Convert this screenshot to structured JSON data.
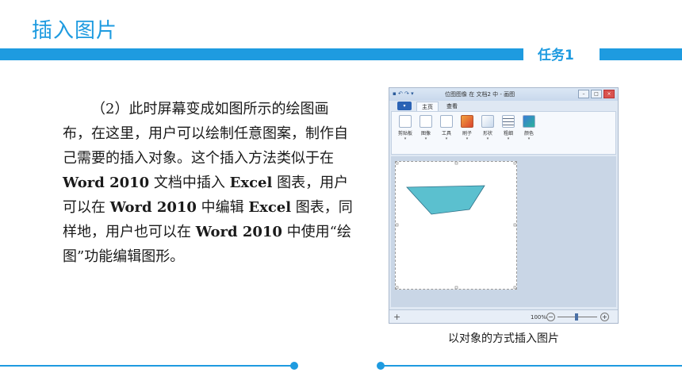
{
  "header": {
    "title": "插入图片",
    "task_label": "任务1"
  },
  "body": {
    "paragraph": [
      {
        "t": "（2）此时屏幕变成如图所示的绘图画布，在这里，用户可以绘制任意图案，制作自己需要的插入对象。这个插入方法类似于在 ",
        "b": false
      },
      {
        "t": "Word 2010",
        "b": true
      },
      {
        "t": " 文档中插入 ",
        "b": false
      },
      {
        "t": "Excel",
        "b": true
      },
      {
        "t": " 图表，用户可以在 ",
        "b": false
      },
      {
        "t": "Word 2010",
        "b": true
      },
      {
        "t": " 中编辑 ",
        "b": false
      },
      {
        "t": "Excel",
        "b": true
      },
      {
        "t": " 图表，同样地，用户也可以在 ",
        "b": false
      },
      {
        "t": "Word 2010",
        "b": true
      },
      {
        "t": " 中使用“绘图”功能编辑图形。",
        "b": false
      }
    ]
  },
  "screenshot": {
    "window_title": "位图图像 在 文档2 中 - 画图",
    "file_tab": "▾",
    "tabs": [
      "主页",
      "查看"
    ],
    "ribbon_groups": [
      {
        "label": "剪贴板",
        "icon": "clipboard-icon"
      },
      {
        "label": "图像",
        "icon": "image-icon"
      },
      {
        "label": "工具",
        "icon": "tools-icon"
      },
      {
        "label": "刷子",
        "icon": "brush-icon"
      },
      {
        "label": "形状",
        "icon": "shapes-icon"
      },
      {
        "label": "粗细",
        "icon": "line-width-icon"
      },
      {
        "label": "颜色",
        "icon": "color-icon"
      }
    ],
    "zoom": "100%",
    "shape_fill": "#5bc0cf"
  },
  "caption": "以对象的方式插入图片",
  "colors": {
    "accent": "#1e9be0",
    "text": "#1a1a1a"
  }
}
